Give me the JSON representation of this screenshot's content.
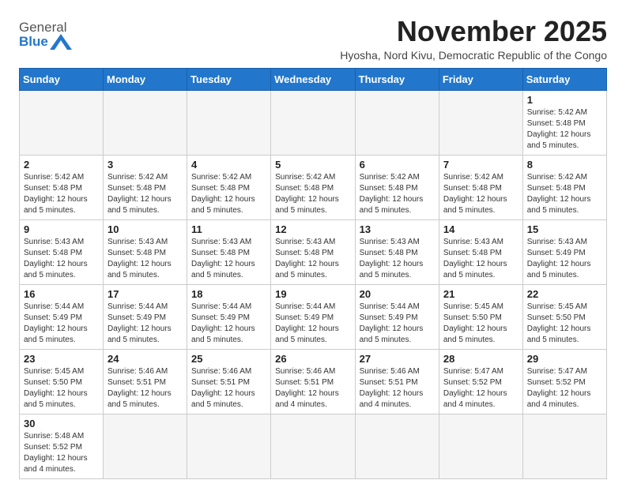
{
  "logo": {
    "text_general": "General",
    "text_blue": "Blue"
  },
  "title": "November 2025",
  "subtitle": "Hyosha, Nord Kivu, Democratic Republic of the Congo",
  "days_of_week": [
    "Sunday",
    "Monday",
    "Tuesday",
    "Wednesday",
    "Thursday",
    "Friday",
    "Saturday"
  ],
  "weeks": [
    [
      {
        "day": null,
        "info": null
      },
      {
        "day": null,
        "info": null
      },
      {
        "day": null,
        "info": null
      },
      {
        "day": null,
        "info": null
      },
      {
        "day": null,
        "info": null
      },
      {
        "day": null,
        "info": null
      },
      {
        "day": "1",
        "info": "Sunrise: 5:42 AM\nSunset: 5:48 PM\nDaylight: 12 hours and 5 minutes."
      }
    ],
    [
      {
        "day": "2",
        "info": "Sunrise: 5:42 AM\nSunset: 5:48 PM\nDaylight: 12 hours and 5 minutes."
      },
      {
        "day": "3",
        "info": "Sunrise: 5:42 AM\nSunset: 5:48 PM\nDaylight: 12 hours and 5 minutes."
      },
      {
        "day": "4",
        "info": "Sunrise: 5:42 AM\nSunset: 5:48 PM\nDaylight: 12 hours and 5 minutes."
      },
      {
        "day": "5",
        "info": "Sunrise: 5:42 AM\nSunset: 5:48 PM\nDaylight: 12 hours and 5 minutes."
      },
      {
        "day": "6",
        "info": "Sunrise: 5:42 AM\nSunset: 5:48 PM\nDaylight: 12 hours and 5 minutes."
      },
      {
        "day": "7",
        "info": "Sunrise: 5:42 AM\nSunset: 5:48 PM\nDaylight: 12 hours and 5 minutes."
      },
      {
        "day": "8",
        "info": "Sunrise: 5:42 AM\nSunset: 5:48 PM\nDaylight: 12 hours and 5 minutes."
      }
    ],
    [
      {
        "day": "9",
        "info": "Sunrise: 5:43 AM\nSunset: 5:48 PM\nDaylight: 12 hours and 5 minutes."
      },
      {
        "day": "10",
        "info": "Sunrise: 5:43 AM\nSunset: 5:48 PM\nDaylight: 12 hours and 5 minutes."
      },
      {
        "day": "11",
        "info": "Sunrise: 5:43 AM\nSunset: 5:48 PM\nDaylight: 12 hours and 5 minutes."
      },
      {
        "day": "12",
        "info": "Sunrise: 5:43 AM\nSunset: 5:48 PM\nDaylight: 12 hours and 5 minutes."
      },
      {
        "day": "13",
        "info": "Sunrise: 5:43 AM\nSunset: 5:48 PM\nDaylight: 12 hours and 5 minutes."
      },
      {
        "day": "14",
        "info": "Sunrise: 5:43 AM\nSunset: 5:48 PM\nDaylight: 12 hours and 5 minutes."
      },
      {
        "day": "15",
        "info": "Sunrise: 5:43 AM\nSunset: 5:49 PM\nDaylight: 12 hours and 5 minutes."
      }
    ],
    [
      {
        "day": "16",
        "info": "Sunrise: 5:44 AM\nSunset: 5:49 PM\nDaylight: 12 hours and 5 minutes."
      },
      {
        "day": "17",
        "info": "Sunrise: 5:44 AM\nSunset: 5:49 PM\nDaylight: 12 hours and 5 minutes."
      },
      {
        "day": "18",
        "info": "Sunrise: 5:44 AM\nSunset: 5:49 PM\nDaylight: 12 hours and 5 minutes."
      },
      {
        "day": "19",
        "info": "Sunrise: 5:44 AM\nSunset: 5:49 PM\nDaylight: 12 hours and 5 minutes."
      },
      {
        "day": "20",
        "info": "Sunrise: 5:44 AM\nSunset: 5:49 PM\nDaylight: 12 hours and 5 minutes."
      },
      {
        "day": "21",
        "info": "Sunrise: 5:45 AM\nSunset: 5:50 PM\nDaylight: 12 hours and 5 minutes."
      },
      {
        "day": "22",
        "info": "Sunrise: 5:45 AM\nSunset: 5:50 PM\nDaylight: 12 hours and 5 minutes."
      }
    ],
    [
      {
        "day": "23",
        "info": "Sunrise: 5:45 AM\nSunset: 5:50 PM\nDaylight: 12 hours and 5 minutes."
      },
      {
        "day": "24",
        "info": "Sunrise: 5:46 AM\nSunset: 5:51 PM\nDaylight: 12 hours and 5 minutes."
      },
      {
        "day": "25",
        "info": "Sunrise: 5:46 AM\nSunset: 5:51 PM\nDaylight: 12 hours and 5 minutes."
      },
      {
        "day": "26",
        "info": "Sunrise: 5:46 AM\nSunset: 5:51 PM\nDaylight: 12 hours and 4 minutes."
      },
      {
        "day": "27",
        "info": "Sunrise: 5:46 AM\nSunset: 5:51 PM\nDaylight: 12 hours and 4 minutes."
      },
      {
        "day": "28",
        "info": "Sunrise: 5:47 AM\nSunset: 5:52 PM\nDaylight: 12 hours and 4 minutes."
      },
      {
        "day": "29",
        "info": "Sunrise: 5:47 AM\nSunset: 5:52 PM\nDaylight: 12 hours and 4 minutes."
      }
    ],
    [
      {
        "day": "30",
        "info": "Sunrise: 5:48 AM\nSunset: 5:52 PM\nDaylight: 12 hours and 4 minutes."
      },
      {
        "day": null,
        "info": null
      },
      {
        "day": null,
        "info": null
      },
      {
        "day": null,
        "info": null
      },
      {
        "day": null,
        "info": null
      },
      {
        "day": null,
        "info": null
      },
      {
        "day": null,
        "info": null
      }
    ]
  ]
}
